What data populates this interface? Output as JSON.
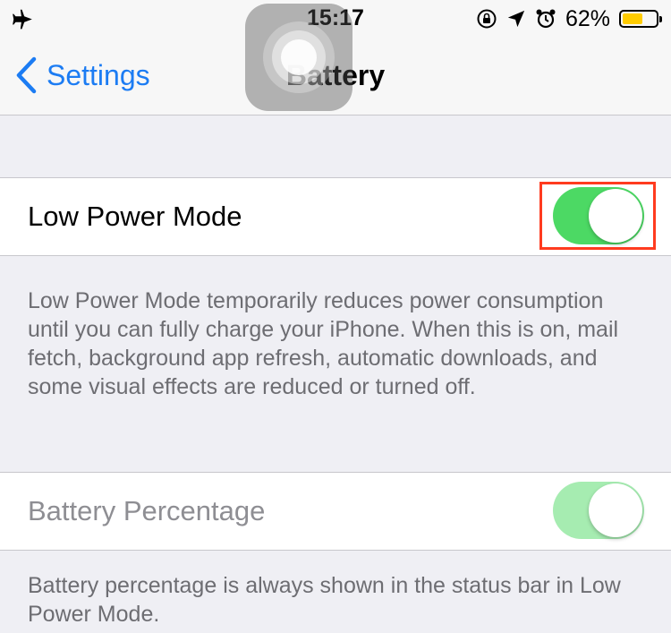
{
  "status_bar": {
    "time": "15:17",
    "battery_percent": "62%",
    "battery_level": 0.62,
    "battery_color": "#ffcc00",
    "icons": [
      "airplane-icon",
      "rotation-lock-icon",
      "location-arrow-icon",
      "alarm-icon",
      "battery-icon"
    ]
  },
  "nav": {
    "back_label": "Settings",
    "title": "Battery"
  },
  "low_power": {
    "label": "Low Power Mode",
    "on": true,
    "highlight_color": "#ff3b1f",
    "description": "Low Power Mode temporarily reduces power consumption until you can fully charge your iPhone. When this is on, mail fetch, background app refresh, automatic downloads, and some visual effects are reduced or turned off."
  },
  "battery_percentage": {
    "label": "Battery Percentage",
    "on": true,
    "disabled": true,
    "description": "Battery percentage is always shown in the status bar in Low Power Mode."
  },
  "colors": {
    "accent": "#1c7cf3",
    "switch_on": "#4cd964",
    "switch_disabled": "#a6ecb1"
  }
}
